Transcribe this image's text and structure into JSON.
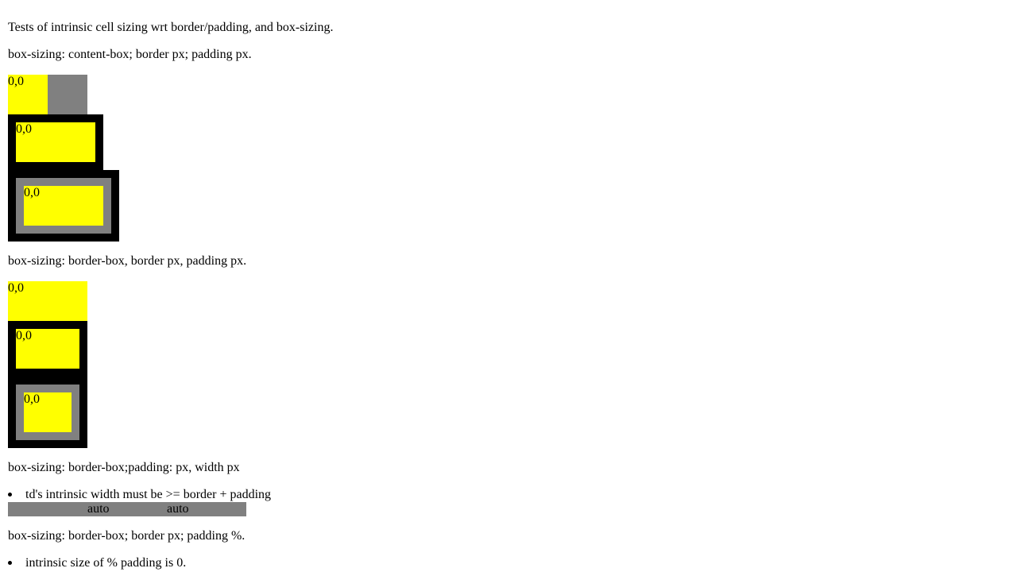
{
  "intro": "Tests of intrinsic cell sizing wrt border/padding, and box-sizing.",
  "section_content_box": {
    "heading": "box-sizing: content-box; border px; padding px.",
    "cells": [
      "0,0",
      "0,0",
      "0,0"
    ]
  },
  "section_border_box": {
    "heading": "box-sizing: border-box, border px, padding px.",
    "cells": [
      "0,0",
      "0,0",
      "0,0"
    ]
  },
  "section_border_box_width": {
    "heading": "box-sizing: border-box;padding: px, width px",
    "note": "td's intrinsic width must be >= border + padding",
    "row": [
      "auto",
      "auto"
    ]
  },
  "section_border_box_percent": {
    "heading": "box-sizing: border-box; border px; padding %.",
    "note": "intrinsic size of % padding is 0."
  },
  "colors": {
    "yellow": "#ffff00",
    "gray": "#808080",
    "black": "#000000"
  }
}
